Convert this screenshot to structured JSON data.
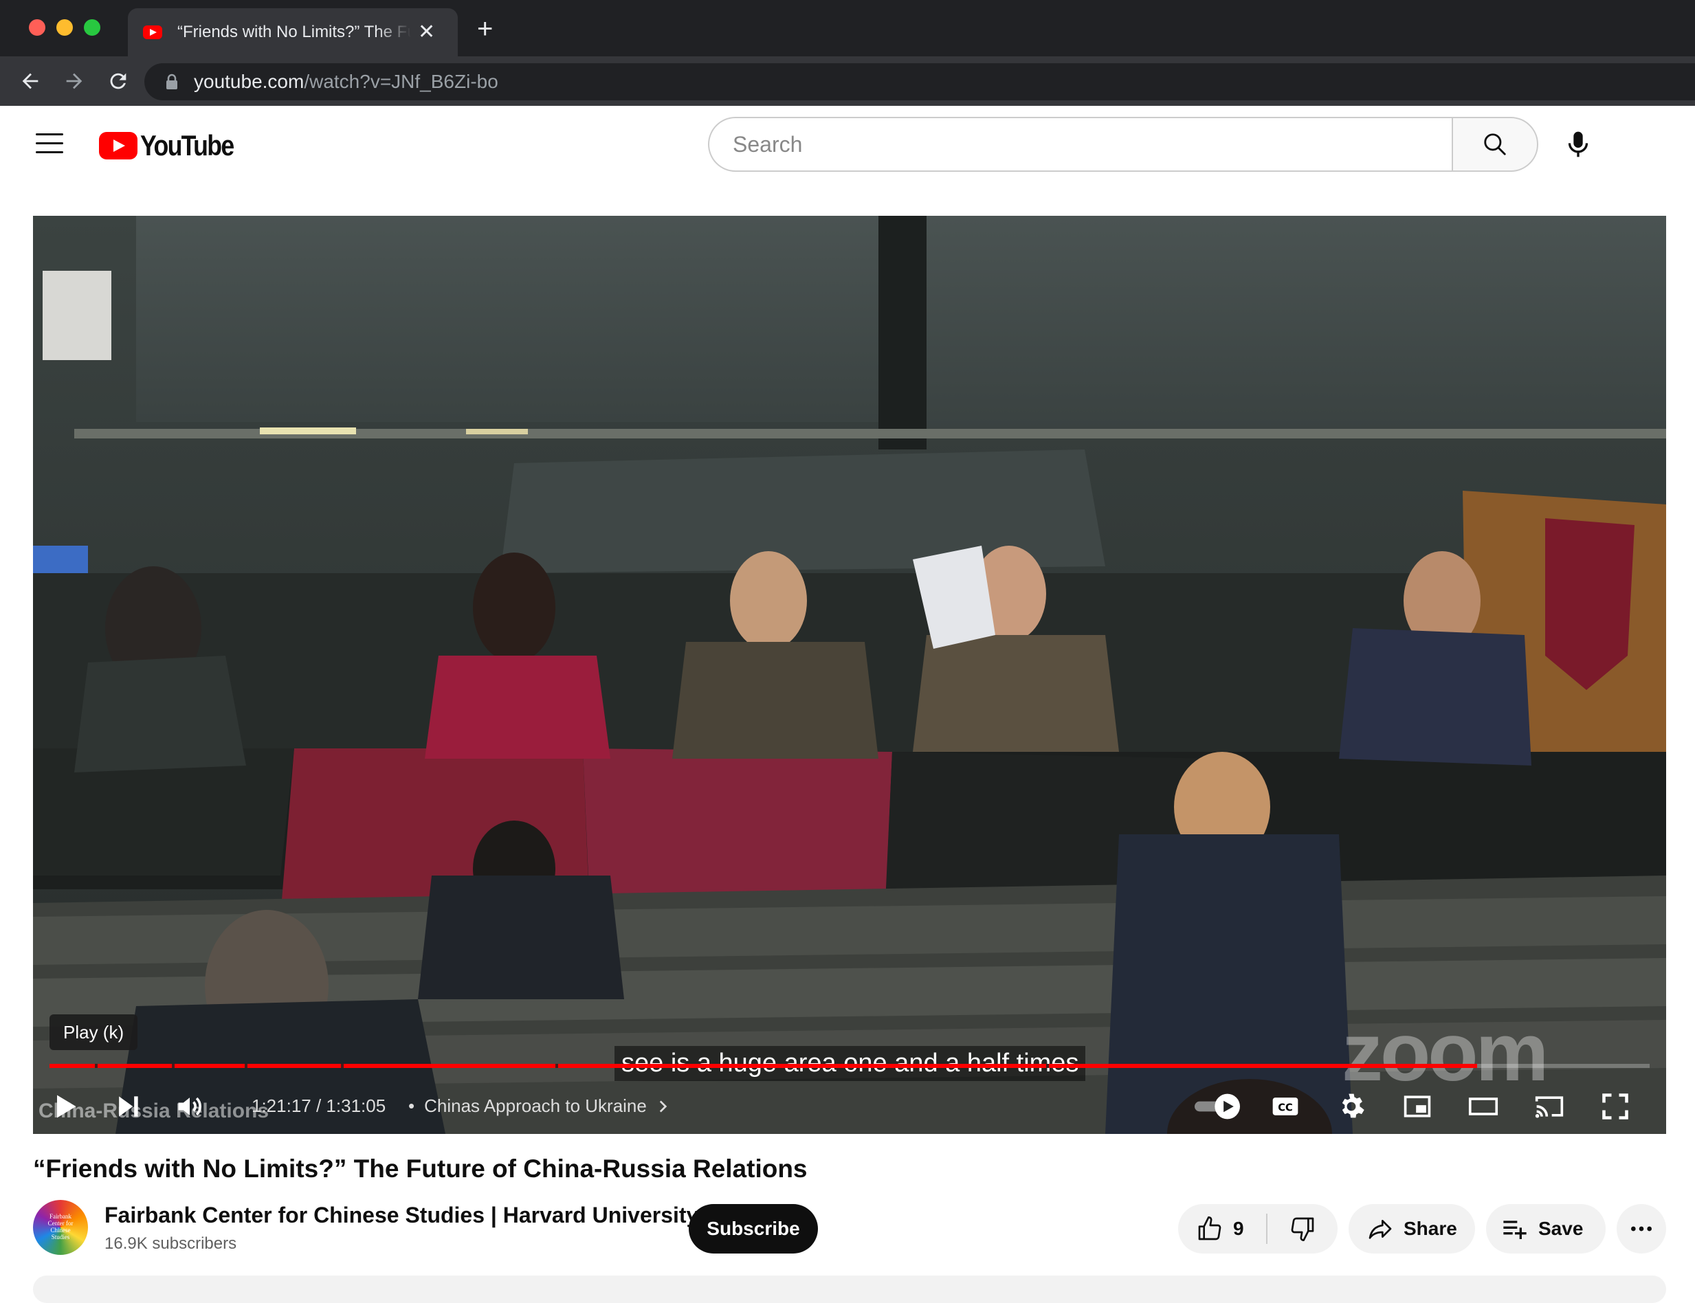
{
  "browser": {
    "tab_title": "“Friends with No Limits?” The Future of China-Russia Relations",
    "tab_close": "✕",
    "new_tab": "+",
    "url_host": "youtube.com",
    "url_path": "/watch?v=JNf_B6Zi-bo"
  },
  "masthead": {
    "logo_text": "YouTube",
    "search_placeholder": "Search"
  },
  "player": {
    "tooltip": "Play (k)",
    "caption": "see is a huge area one and a half times",
    "overlay_text": "China-Russia Relations",
    "watermark": "zoom",
    "current_time": "1:21:17",
    "time_separator": " / ",
    "duration": "1:31:05",
    "chapter_bullet": "•",
    "chapter_title": "Chinas Approach to Ukraine",
    "progress_fraction": 0.892,
    "brand_color": "#ff0000"
  },
  "video": {
    "title": "“Friends with No Limits?” The Future of China-Russia Relations"
  },
  "channel": {
    "name": "Fairbank Center for Chinese Studies | Harvard University",
    "subscribers": "16.9K subscribers",
    "avatar_text": "Fairbank Center for Chinese Studies",
    "subscribe_label": "Subscribe"
  },
  "actions": {
    "like_count": "9",
    "share_label": "Share",
    "save_label": "Save"
  },
  "icons": {
    "back": "arrow-left-icon",
    "forward": "arrow-right-icon",
    "reload": "reload-icon",
    "lock": "lock-icon",
    "menu": "hamburger-icon",
    "search": "search-icon",
    "mic": "microphone-icon",
    "play": "play-icon",
    "next": "skip-next-icon",
    "volume": "volume-icon",
    "autoplay": "autoplay-toggle-icon",
    "cc": "closed-captions-icon",
    "settings": "gear-icon",
    "miniplayer": "miniplayer-icon",
    "theater": "theater-mode-icon",
    "cast": "cast-icon",
    "fullscreen": "fullscreen-icon",
    "like": "thumbs-up-icon",
    "dislike": "thumbs-down-icon",
    "share": "share-arrow-icon",
    "save": "playlist-add-icon",
    "more": "more-horizontal-icon"
  }
}
